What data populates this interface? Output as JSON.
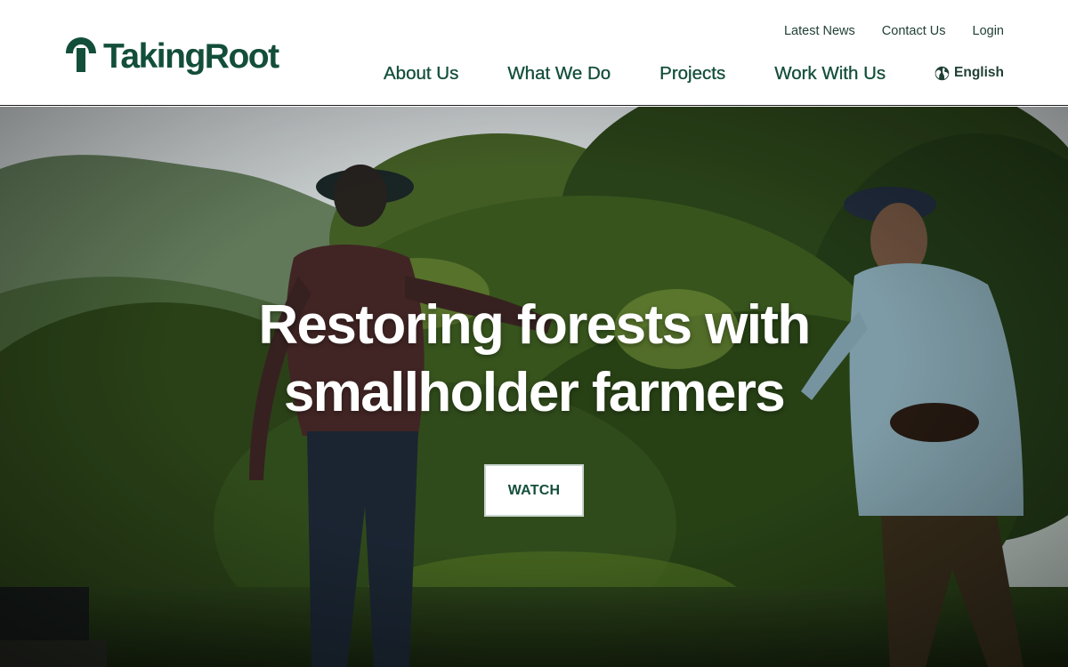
{
  "brand": {
    "name": "TakingRoot",
    "color": "#134e3b"
  },
  "utility_nav": {
    "items": [
      {
        "label": "Latest News"
      },
      {
        "label": "Contact Us"
      },
      {
        "label": "Login"
      }
    ]
  },
  "main_nav": {
    "items": [
      {
        "label": "About Us"
      },
      {
        "label": "What We Do"
      },
      {
        "label": "Projects"
      },
      {
        "label": "Work With Us"
      }
    ]
  },
  "language": {
    "icon": "globe-icon",
    "label": "English"
  },
  "hero": {
    "title_line1": "Restoring forests with",
    "title_line2": "smallholder farmers",
    "cta_label": "WATCH"
  },
  "colors": {
    "primary": "#134e3b",
    "text_dark": "#1f3f35",
    "hero_text": "#ffffff",
    "border": "#1c1c1c"
  }
}
